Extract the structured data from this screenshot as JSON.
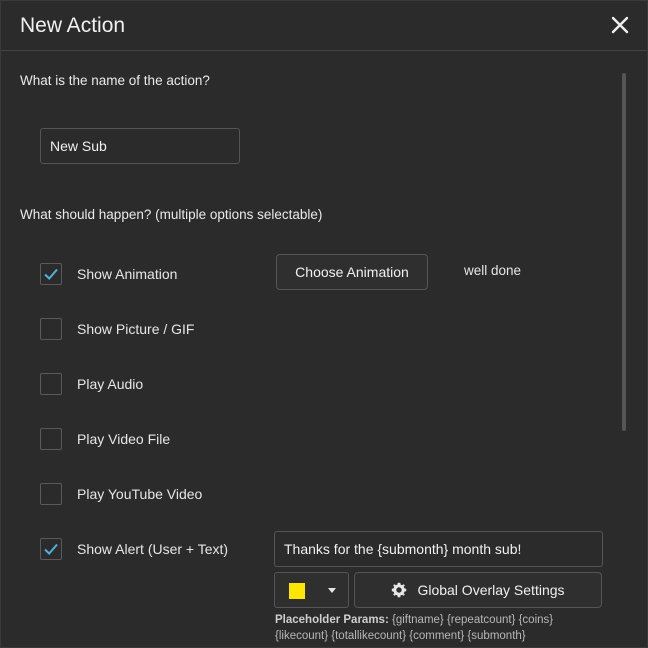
{
  "dialog": {
    "title": "New Action",
    "close_icon": "close-icon"
  },
  "name_section": {
    "question": "What is the name of the action?",
    "value": "New Sub"
  },
  "options_section": {
    "question": "What should happen? (multiple options selectable)",
    "options": [
      {
        "label": "Show Animation",
        "checked": true
      },
      {
        "label": "Show Picture / GIF",
        "checked": false
      },
      {
        "label": "Play Audio",
        "checked": false
      },
      {
        "label": "Play Video File",
        "checked": false
      },
      {
        "label": "Play YouTube Video",
        "checked": false
      },
      {
        "label": "Show Alert (User + Text)",
        "checked": true
      }
    ]
  },
  "animation": {
    "button_label": "Choose Animation",
    "selected": "well done"
  },
  "alert": {
    "text_value": "Thanks for the {submonth} month sub!",
    "color": "#ffe600",
    "settings_button_label": "Global Overlay Settings",
    "settings_icon": "gear-icon",
    "placeholder_title": "Placeholder Params:",
    "placeholder_list": "{giftname} {repeatcount} {coins} {likecount} {totallikecount} {comment} {submonth}"
  },
  "colors": {
    "background": "#2b2b2b",
    "check_accent": "#4fb0e0",
    "border": "#555555"
  }
}
